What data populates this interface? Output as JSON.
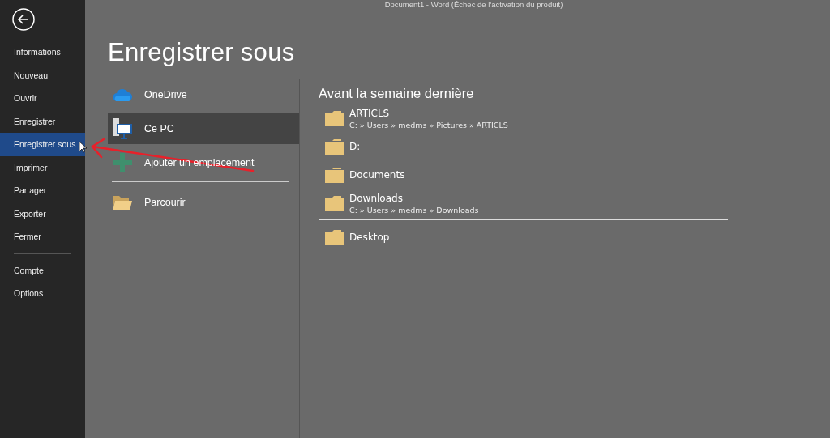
{
  "window": {
    "title": "Document1 - Word (Échec de l'activation du produit)"
  },
  "sidebar": {
    "items": [
      {
        "label": "Informations",
        "selected": false
      },
      {
        "label": "Nouveau",
        "selected": false
      },
      {
        "label": "Ouvrir",
        "selected": false
      },
      {
        "label": "Enregistrer",
        "selected": false
      },
      {
        "label": "Enregistrer sous",
        "selected": true
      },
      {
        "label": "Imprimer",
        "selected": false
      },
      {
        "label": "Partager",
        "selected": false
      },
      {
        "label": "Exporter",
        "selected": false
      },
      {
        "label": "Fermer",
        "selected": false
      }
    ],
    "bottom_items": [
      {
        "label": "Compte",
        "selected": false
      },
      {
        "label": "Options",
        "selected": false
      }
    ]
  },
  "page_title": "Enregistrer sous",
  "locations": [
    {
      "kind": "cloud",
      "label": "OneDrive",
      "selected": false
    },
    {
      "kind": "pc",
      "label": "Ce PC",
      "selected": true
    },
    {
      "kind": "add",
      "label": "Ajouter un emplacement",
      "selected": false
    },
    {
      "kind": "browse",
      "label": "Parcourir",
      "selected": false
    }
  ],
  "recent": {
    "heading": "Avant la semaine dernière",
    "folders": [
      {
        "name": "ARTICLS",
        "path": "C: » Users » medms » Pictures » ARTICLS"
      },
      {
        "name": "D:"
      },
      {
        "name": "Documents"
      },
      {
        "name": "Downloads",
        "path": "C: » Users » medms » Downloads"
      }
    ],
    "pinned": [
      {
        "name": "Desktop"
      }
    ]
  }
}
